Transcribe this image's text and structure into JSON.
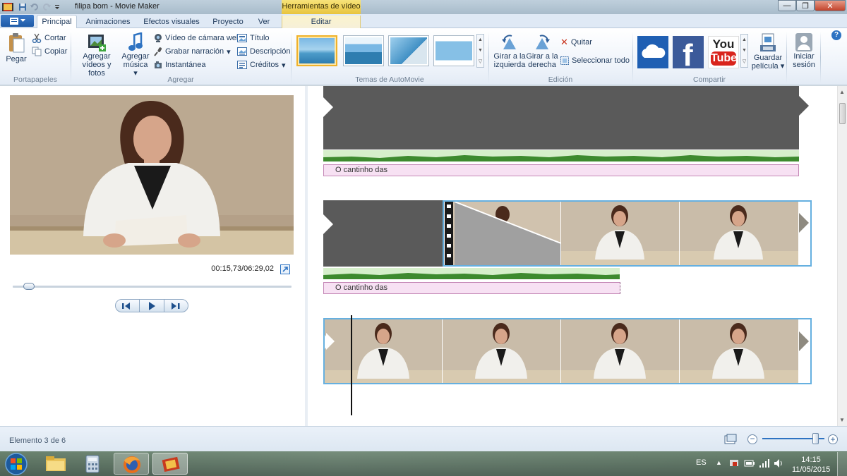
{
  "window": {
    "title": "filipa bom  - Movie Maker",
    "context_tab_group": "Herramientas de vídeo"
  },
  "tabs": [
    {
      "label": "Principal",
      "active": true
    },
    {
      "label": "Animaciones"
    },
    {
      "label": "Efectos visuales"
    },
    {
      "label": "Proyecto"
    },
    {
      "label": "Ver"
    },
    {
      "label": "Editar",
      "contextual": true
    }
  ],
  "ribbon": {
    "clipboard": {
      "label": "Portapapeles",
      "paste": "Pegar",
      "cut": "Cortar",
      "copy": "Copiar"
    },
    "add": {
      "label": "Agregar",
      "add_videos_line1": "Agregar",
      "add_videos_line2": "vídeos y fotos",
      "add_music_line1": "Agregar",
      "add_music_line2": "música",
      "webcam": "Vídeo de cámara web",
      "narration": "Grabar narración",
      "snapshot": "Instantánea",
      "title": "Título",
      "caption": "Descripción",
      "credits": "Créditos"
    },
    "themes": {
      "label": "Temas de AutoMovie"
    },
    "editing": {
      "label": "Edición",
      "rotate_left_line1": "Girar a la",
      "rotate_left_line2": "izquierda",
      "rotate_right_line1": "Girar a la",
      "rotate_right_line2": "derecha",
      "remove": "Quitar",
      "select_all": "Seleccionar todo"
    },
    "share": {
      "label": "Compartir",
      "save_line1": "Guardar",
      "save_line2": "película",
      "youtube_line1": "You",
      "youtube_line2": "Tube"
    },
    "signin": {
      "line1": "Iniciar",
      "line2": "sesión"
    }
  },
  "preview": {
    "timecode": "00:15,73/06:29,02",
    "seek_fraction": 0.04
  },
  "storyboard": {
    "rows": [
      {
        "caption": "O cantinho das"
      },
      {
        "caption": "O cantinho das"
      },
      {
        "caption": ""
      }
    ]
  },
  "status": {
    "text": "Elemento 3 de 6",
    "zoom_fraction": 0.9
  },
  "taskbar": {
    "language": "ES",
    "time": "14:15",
    "date": "11/05/2015"
  },
  "colors": {
    "accent": "#1e5aa7",
    "context_tab": "#f0d050",
    "caption_bg": "#f7e1f3",
    "selection": "#66b0e0"
  }
}
